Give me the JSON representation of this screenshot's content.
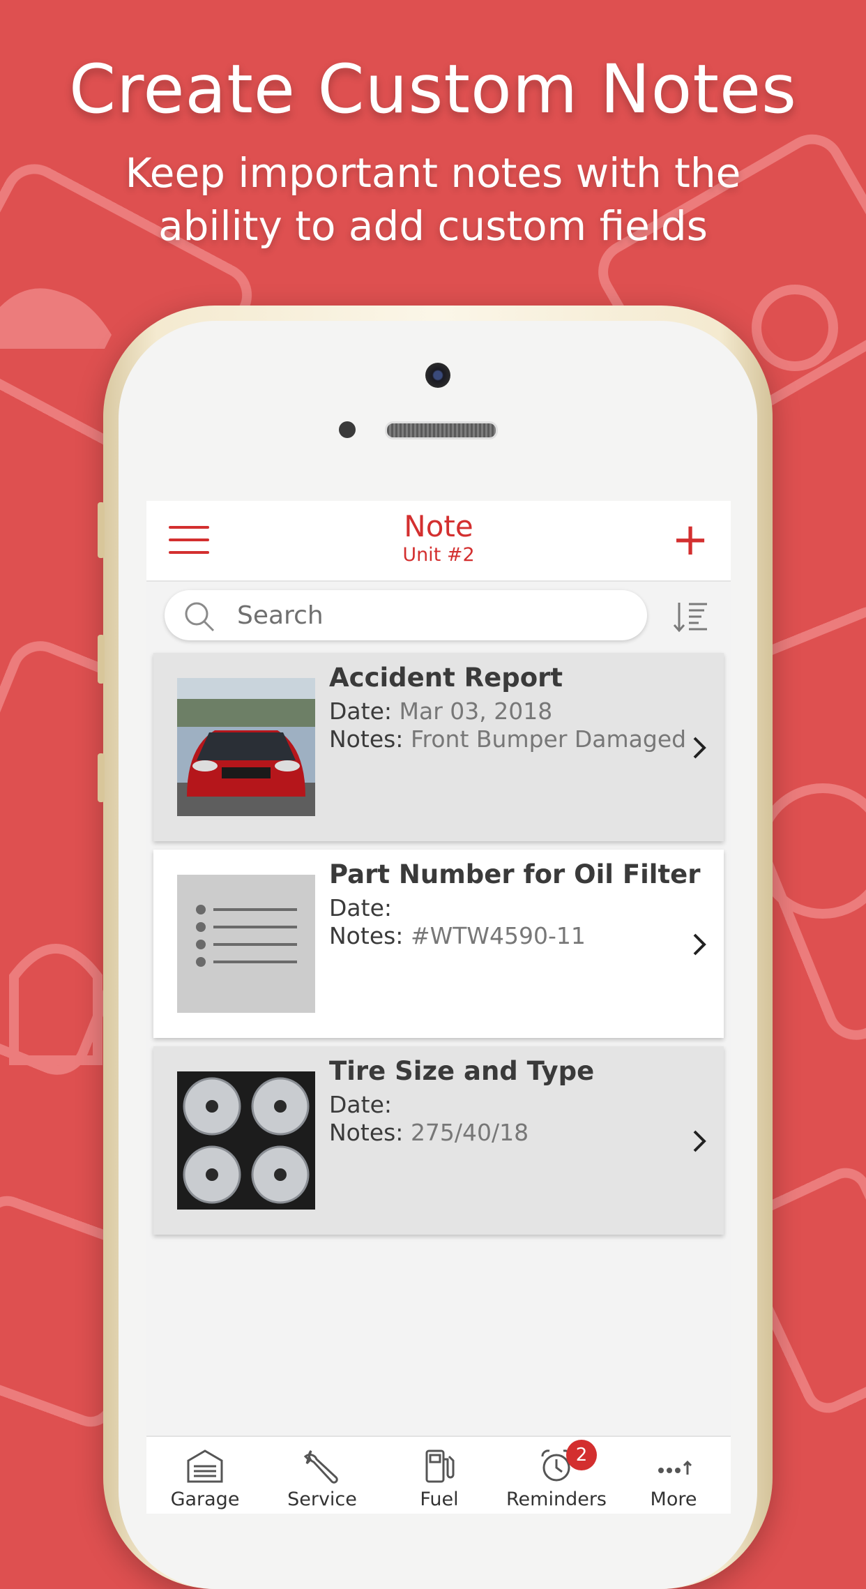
{
  "headline": "Create Custom Notes",
  "subhead": "Keep important notes with the ability to add custom fields",
  "colors": {
    "background": "#de5050",
    "accent": "#d32f2f",
    "card_grey": "#e4e4e4"
  },
  "navbar": {
    "menu_icon": "hamburger-menu-icon",
    "title": "Note",
    "subtitle": "Unit #2",
    "add_icon": "plus-icon"
  },
  "search": {
    "placeholder": "Search",
    "value": "",
    "sort_icon": "sort-list-icon"
  },
  "notes": [
    {
      "title": "Accident Report",
      "date_label": "Date:",
      "date": "Mar 03, 2018",
      "notes_label": "Notes:",
      "notes": "Front Bumper Damaged",
      "thumb": "red-car-photo"
    },
    {
      "title": "Part Number for Oil Filter",
      "date_label": "Date:",
      "date": "",
      "notes_label": "Notes:",
      "notes": "#WTW4590-11",
      "thumb": "list-placeholder-icon"
    },
    {
      "title": "Tire Size and Type",
      "date_label": "Date:",
      "date": "",
      "notes_label": "Notes:",
      "notes": "275/40/18",
      "thumb": "tires-photo"
    }
  ],
  "tabs": [
    {
      "label": "Garage",
      "icon": "garage-icon"
    },
    {
      "label": "Service",
      "icon": "wrench-icon"
    },
    {
      "label": "Fuel",
      "icon": "fuel-pump-icon"
    },
    {
      "label": "Reminders",
      "icon": "alarm-clock-icon",
      "badge": "2"
    },
    {
      "label": "More",
      "icon": "more-icon"
    }
  ]
}
